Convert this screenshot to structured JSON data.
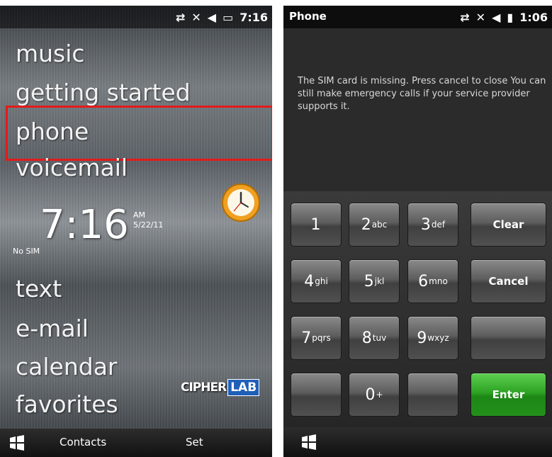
{
  "left": {
    "status": {
      "time": "7:16"
    },
    "menu": [
      {
        "label": "music"
      },
      {
        "label": "getting started"
      },
      {
        "label": "phone"
      },
      {
        "label": "voicemail"
      },
      {
        "label": "text"
      },
      {
        "label": "e-mail"
      },
      {
        "label": "calendar"
      },
      {
        "label": "favorites"
      }
    ],
    "clock": {
      "time": "7:16",
      "ampm": "AM",
      "date": "5/22/11",
      "no_sim": "No SIM"
    },
    "brand": {
      "cipher": "CIPHER",
      "lab": "LAB"
    },
    "taskbar": {
      "left_softkey": "Contacts",
      "right_softkey": "Set"
    }
  },
  "right": {
    "status": {
      "title": "Phone",
      "time": "1:06"
    },
    "message": "The SIM card is missing. Press cancel to close You can still make emergency calls if your service provider supports it.",
    "keys": [
      {
        "num": "1",
        "sub": ""
      },
      {
        "num": "2",
        "sub": "abc"
      },
      {
        "num": "3",
        "sub": "def"
      },
      {
        "num": "4",
        "sub": "ghi"
      },
      {
        "num": "5",
        "sub": "jkl"
      },
      {
        "num": "6",
        "sub": "mno"
      },
      {
        "num": "7",
        "sub": "pqrs"
      },
      {
        "num": "8",
        "sub": "tuv"
      },
      {
        "num": "9",
        "sub": "wxyz"
      },
      {
        "num": "0",
        "sub": "+"
      }
    ],
    "actions": {
      "clear": "Clear",
      "cancel": "Cancel",
      "enter": "Enter"
    }
  },
  "colors": {
    "highlight": "#e41b1b",
    "enter": "#2ea323",
    "brand_lab": "#1f5fb8"
  }
}
